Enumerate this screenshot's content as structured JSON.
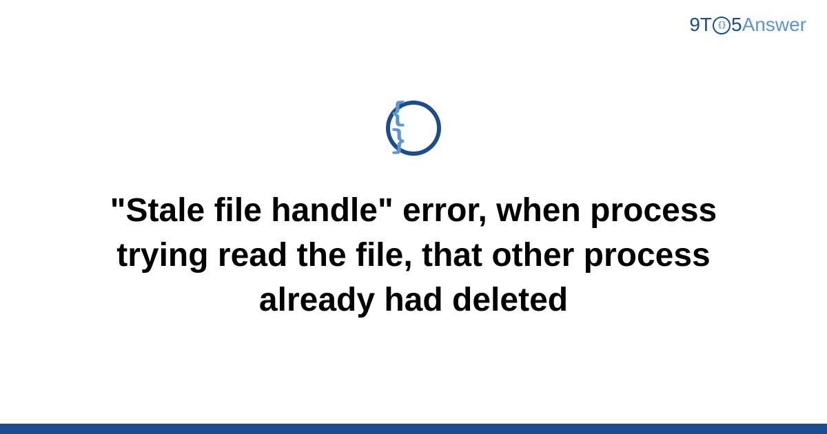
{
  "brand": {
    "part1": "9T",
    "circle_glyph": "{}",
    "part2": "5",
    "part3": "Answer"
  },
  "icon": {
    "glyph": "{ }"
  },
  "main": {
    "title": "\"Stale file handle\" error, when process trying read the file, that other process already had deleted"
  },
  "colors": {
    "primary_dark": "#1a4d8f",
    "primary_light": "#5a95d4",
    "text": "#000000",
    "background": "#ffffff"
  }
}
